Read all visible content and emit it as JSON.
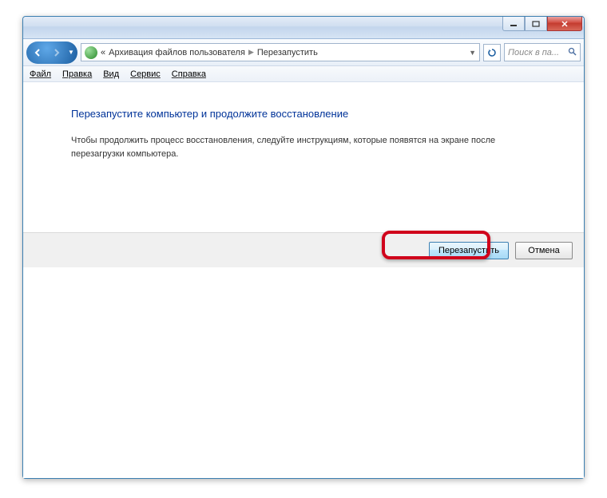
{
  "breadcrumb": {
    "prefix": "«",
    "item1": "Архивация файлов пользователя",
    "item2": "Перезапустить"
  },
  "search": {
    "placeholder": "Поиск в па..."
  },
  "menu": {
    "file": "Файл",
    "edit": "Правка",
    "view": "Вид",
    "tools": "Сервис",
    "help": "Справка"
  },
  "content": {
    "heading": "Перезапустите компьютер и продолжите восстановление",
    "body": "Чтобы продолжить процесс восстановления, следуйте инструкциям, которые появятся на экране после перезагрузки компьютера."
  },
  "buttons": {
    "restart": "Перезапустить",
    "cancel": "Отмена"
  }
}
